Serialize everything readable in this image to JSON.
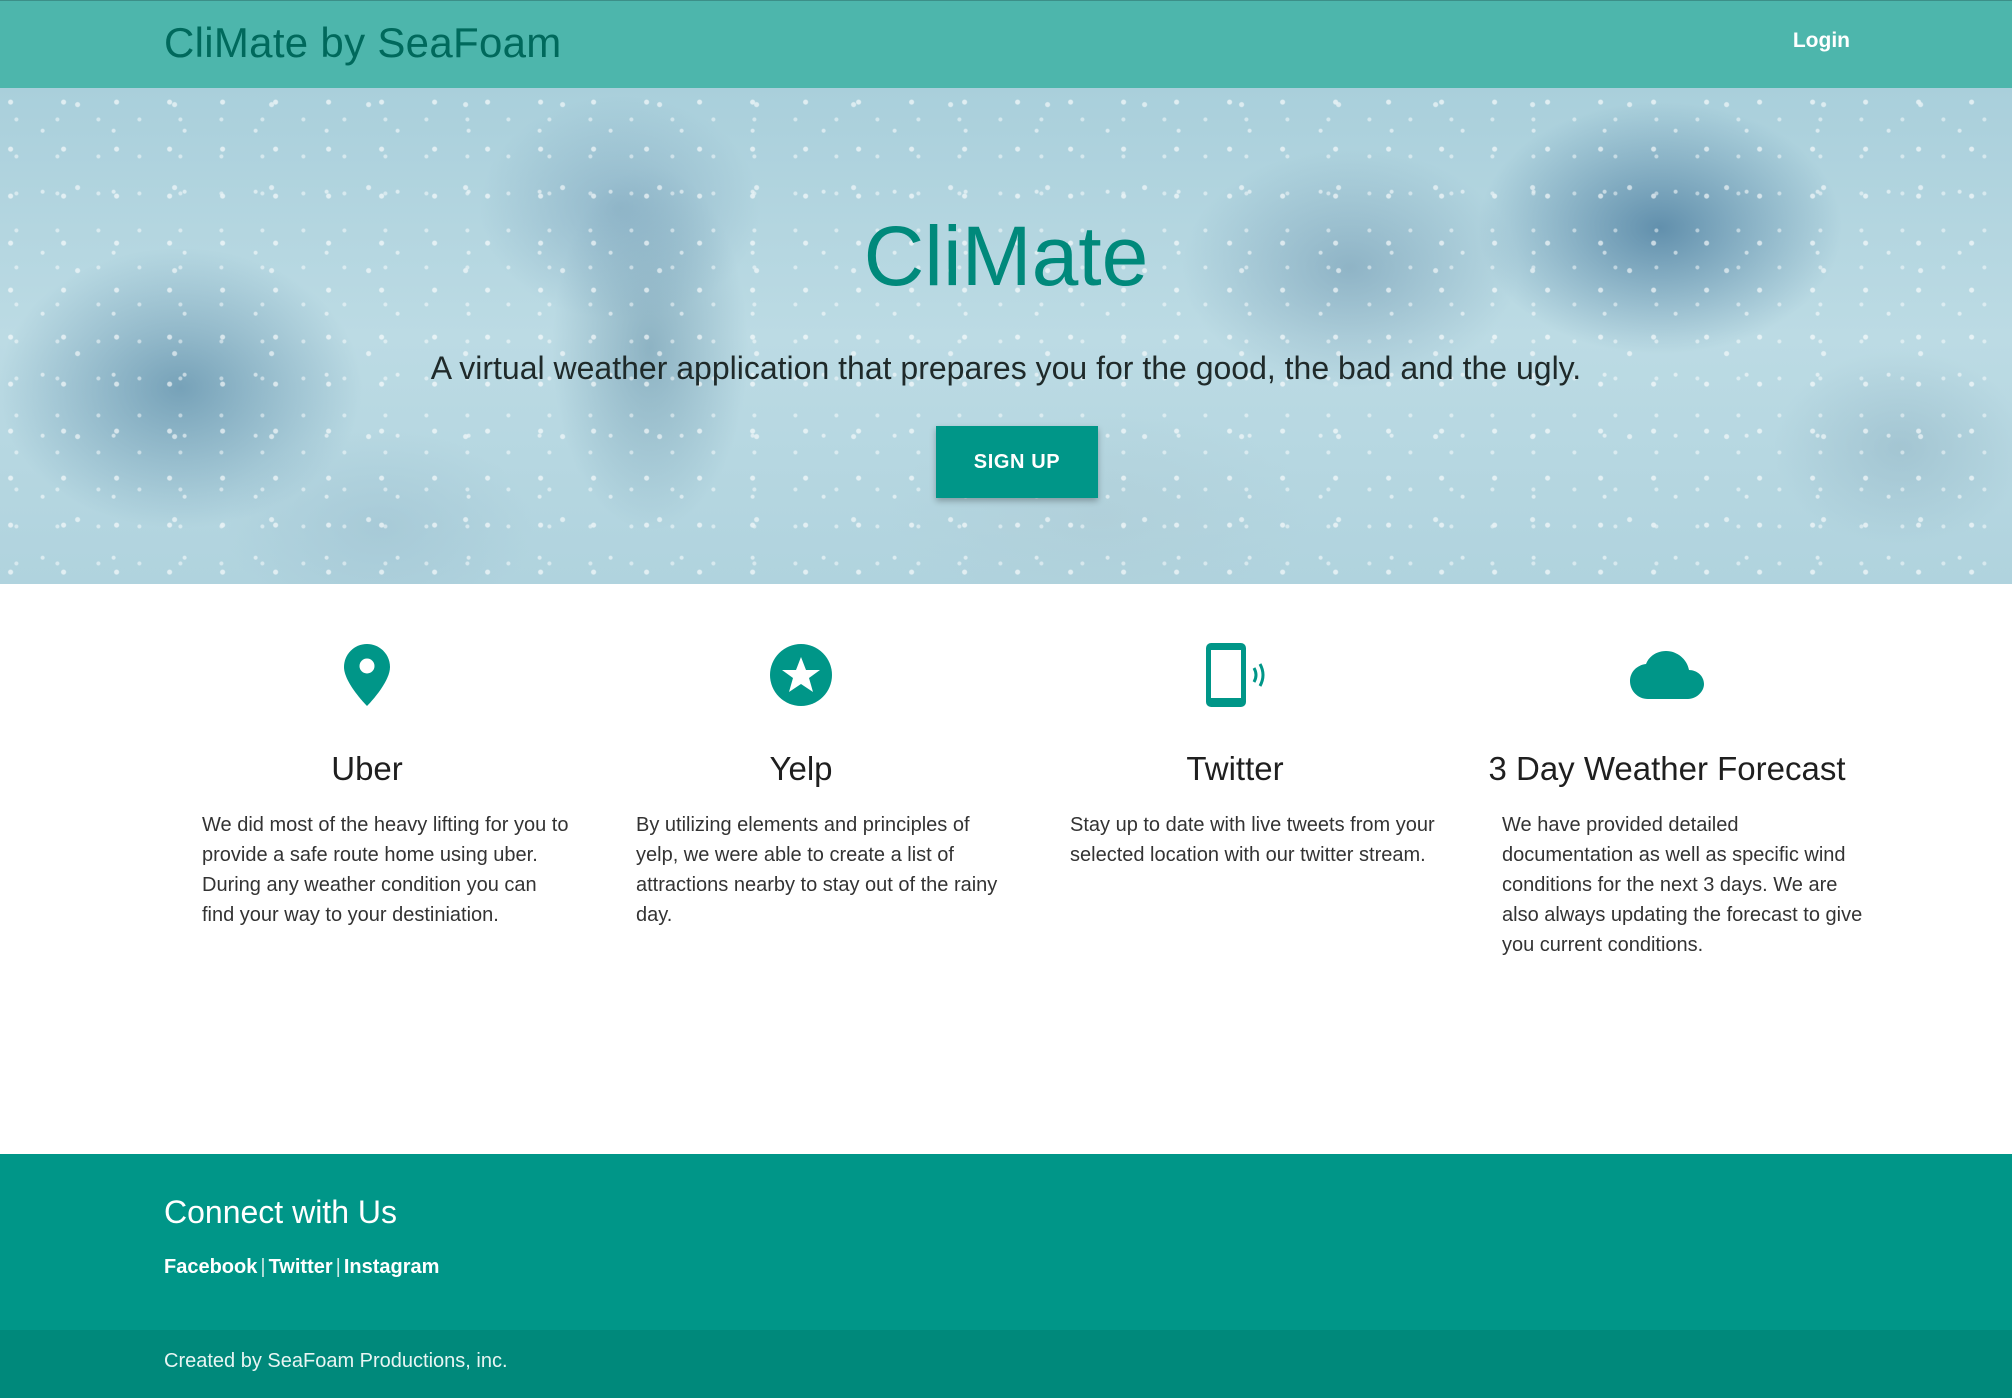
{
  "nav": {
    "brand": "CliMate by SeaFoam",
    "login": "Login"
  },
  "hero": {
    "title": "CliMate",
    "subtitle": "A virtual weather application that prepares you for the good, the bad and the ugly.",
    "signup": "SIGN UP"
  },
  "features": [
    {
      "icon": "map-pin-icon",
      "title": "Uber",
      "text": "We did most of the heavy lifting for you to provide a safe route home using uber. During any weather condition you can find your way to your destiniation."
    },
    {
      "icon": "star-circle-icon",
      "title": "Yelp",
      "text": "By utilizing elements and principles of yelp, we were able to create a list of attractions nearby to stay out of the rainy day."
    },
    {
      "icon": "phone-ringing-icon",
      "title": "Twitter",
      "text": "Stay up to date with live tweets from your selected location with our twitter stream."
    },
    {
      "icon": "cloud-icon",
      "title": "3 Day Weather Forecast",
      "text": "We have provided detailed documentation as well as specific wind conditions for the next 3 days. We are also always updating the forecast to give you current conditions."
    }
  ],
  "footer": {
    "heading": "Connect with Us",
    "links": [
      "Facebook",
      "Twitter",
      "Instagram"
    ],
    "separator": "|",
    "copyright": "Created by SeaFoam Productions, inc."
  },
  "colors": {
    "nav_bg": "#4db6ac",
    "brand_text": "#00695c",
    "accent": "#009688",
    "footer_bottom": "#00897b"
  }
}
